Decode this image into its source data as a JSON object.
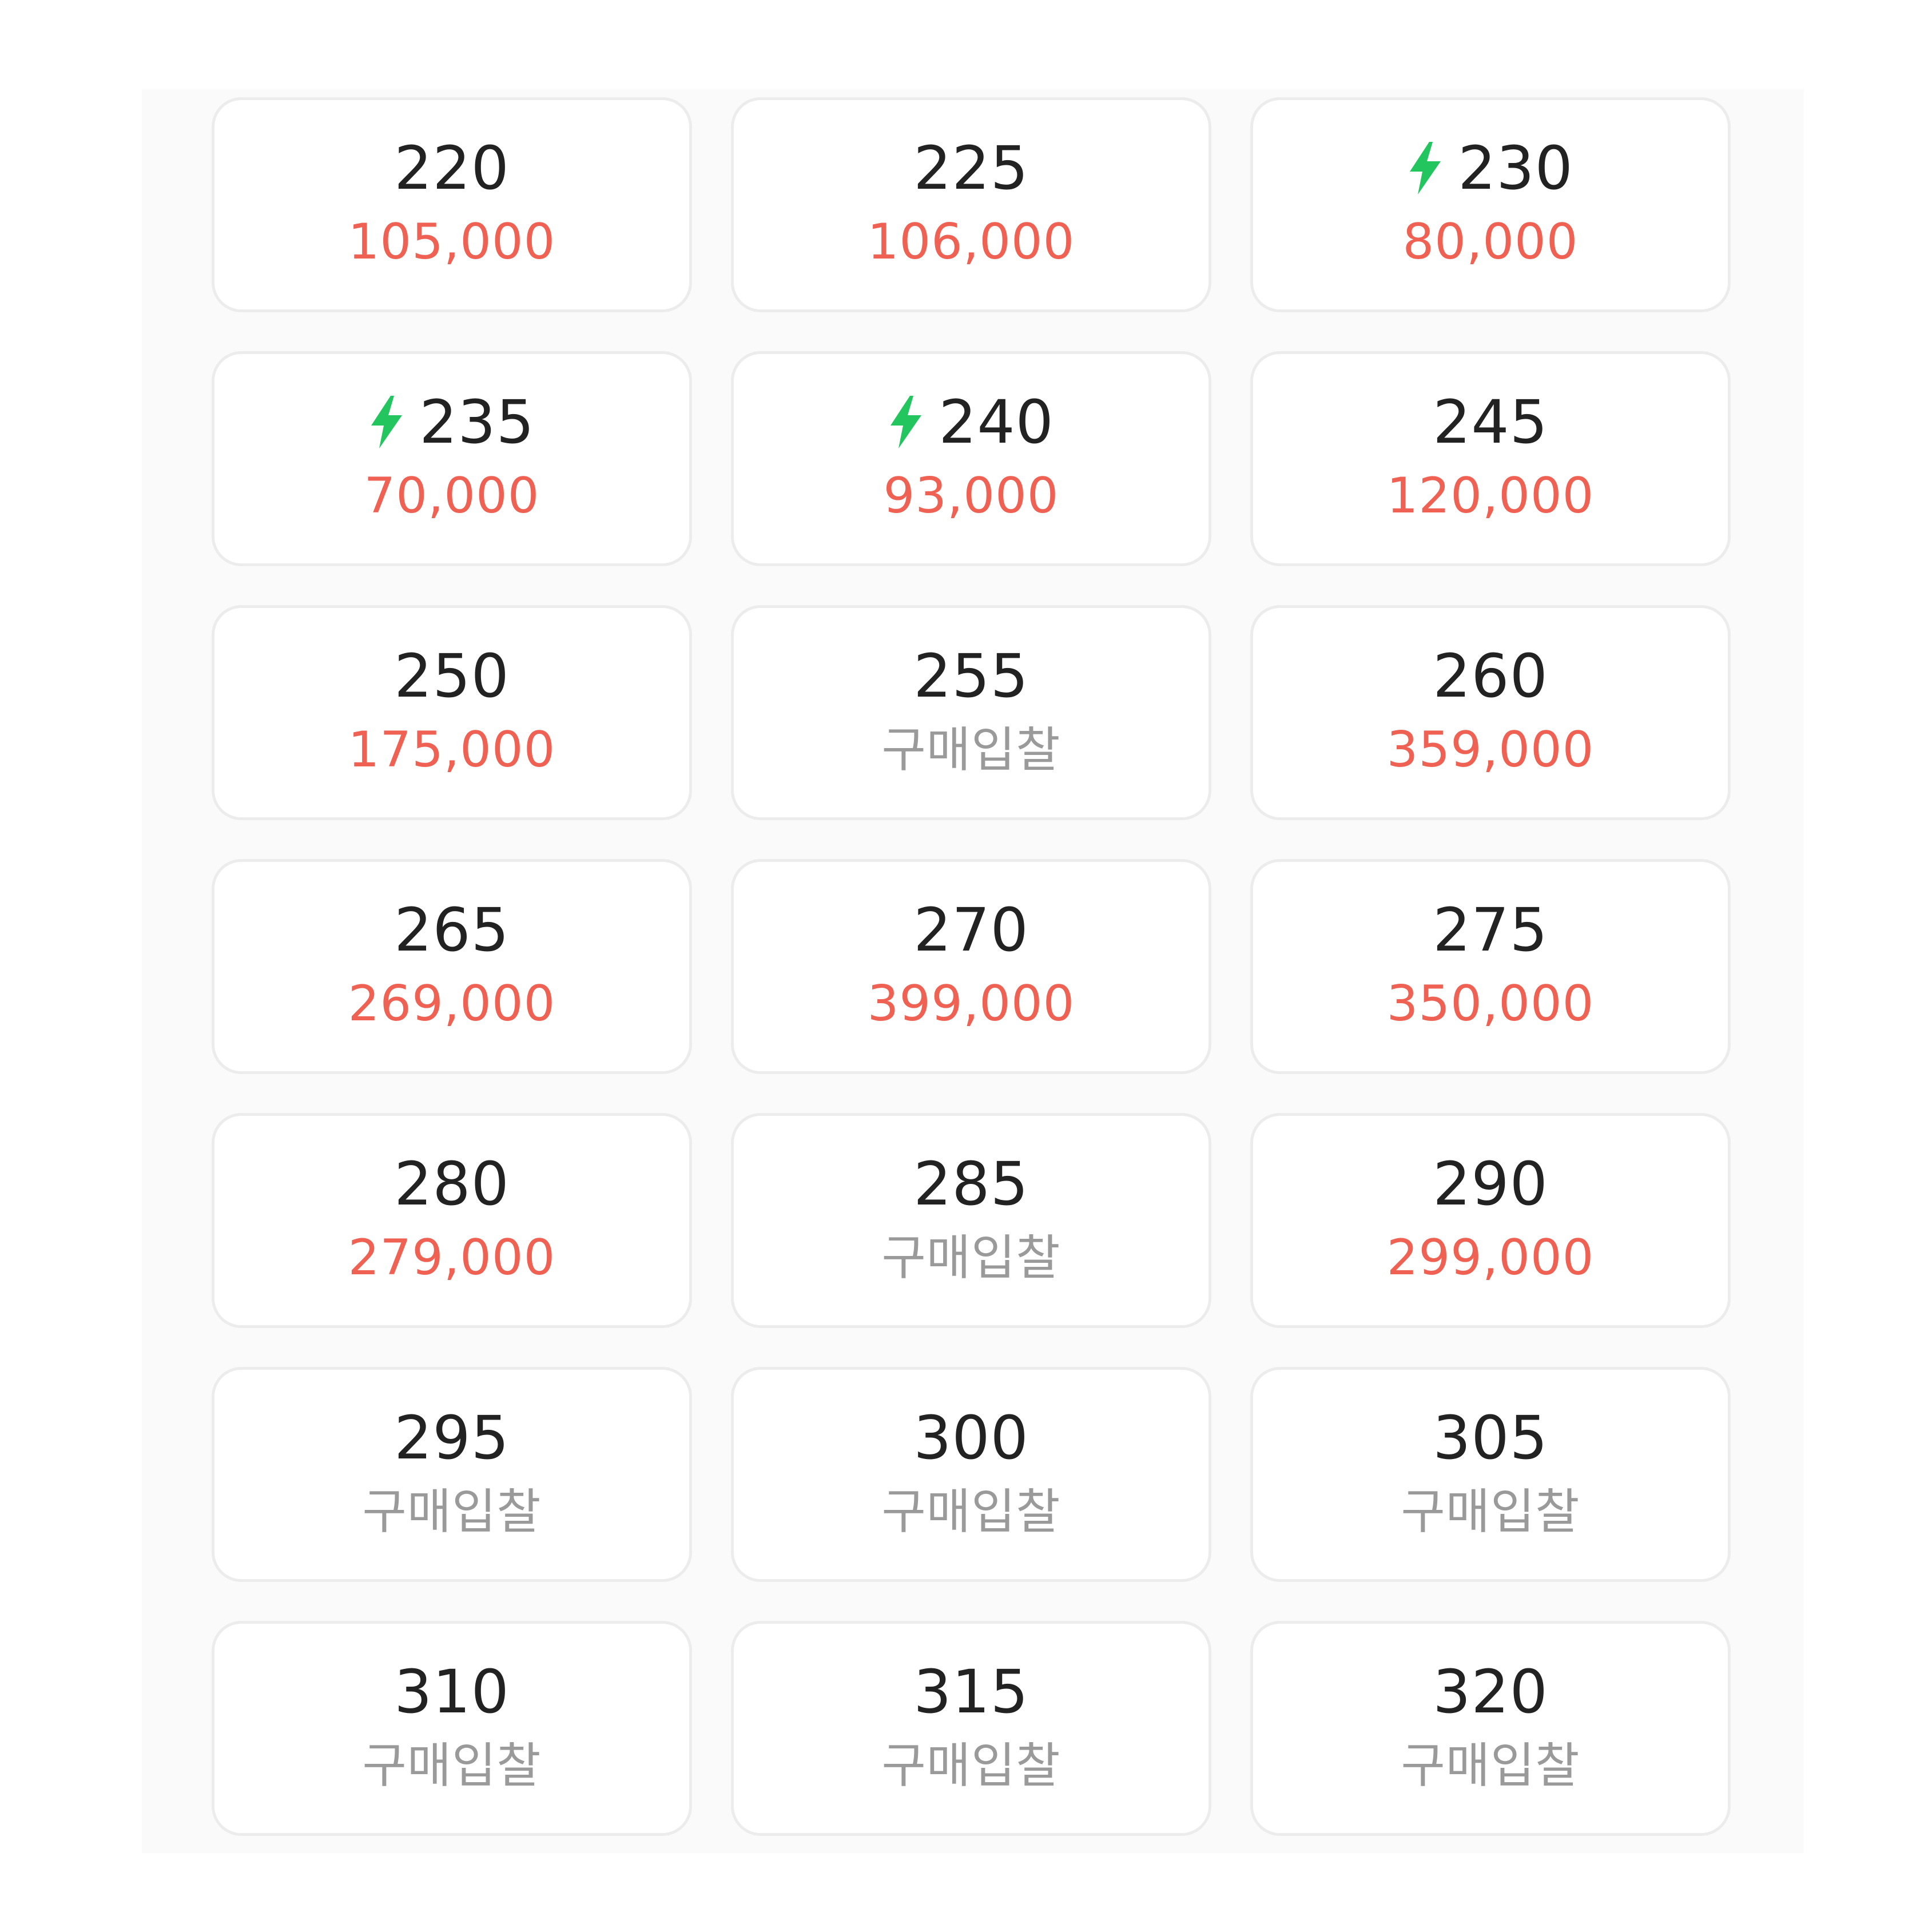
{
  "size_options": [
    {
      "size": "220",
      "price": "105,000",
      "is_bid": false,
      "fast_delivery": false
    },
    {
      "size": "225",
      "price": "106,000",
      "is_bid": false,
      "fast_delivery": false
    },
    {
      "size": "230",
      "price": "80,000",
      "is_bid": false,
      "fast_delivery": true
    },
    {
      "size": "235",
      "price": "70,000",
      "is_bid": false,
      "fast_delivery": true
    },
    {
      "size": "240",
      "price": "93,000",
      "is_bid": false,
      "fast_delivery": true
    },
    {
      "size": "245",
      "price": "120,000",
      "is_bid": false,
      "fast_delivery": false
    },
    {
      "size": "250",
      "price": "175,000",
      "is_bid": false,
      "fast_delivery": false
    },
    {
      "size": "255",
      "price": "구매입찰",
      "is_bid": true,
      "fast_delivery": false
    },
    {
      "size": "260",
      "price": "359,000",
      "is_bid": false,
      "fast_delivery": false
    },
    {
      "size": "265",
      "price": "269,000",
      "is_bid": false,
      "fast_delivery": false
    },
    {
      "size": "270",
      "price": "399,000",
      "is_bid": false,
      "fast_delivery": false
    },
    {
      "size": "275",
      "price": "350,000",
      "is_bid": false,
      "fast_delivery": false
    },
    {
      "size": "280",
      "price": "279,000",
      "is_bid": false,
      "fast_delivery": false
    },
    {
      "size": "285",
      "price": "구매입찰",
      "is_bid": true,
      "fast_delivery": false
    },
    {
      "size": "290",
      "price": "299,000",
      "is_bid": false,
      "fast_delivery": false
    },
    {
      "size": "295",
      "price": "구매입찰",
      "is_bid": true,
      "fast_delivery": false
    },
    {
      "size": "300",
      "price": "구매입찰",
      "is_bid": true,
      "fast_delivery": false
    },
    {
      "size": "305",
      "price": "구매입찰",
      "is_bid": true,
      "fast_delivery": false
    },
    {
      "size": "310",
      "price": "구매입찰",
      "is_bid": true,
      "fast_delivery": false
    },
    {
      "size": "315",
      "price": "구매입찰",
      "is_bid": true,
      "fast_delivery": false
    },
    {
      "size": "320",
      "price": "구매입찰",
      "is_bid": true,
      "fast_delivery": false
    }
  ],
  "colors": {
    "price": "#ef6253",
    "bid": "#9a9a9a",
    "bolt": "#22c55e",
    "size": "#222222"
  },
  "icons": {
    "fast_delivery": "lightning-bolt-icon"
  }
}
